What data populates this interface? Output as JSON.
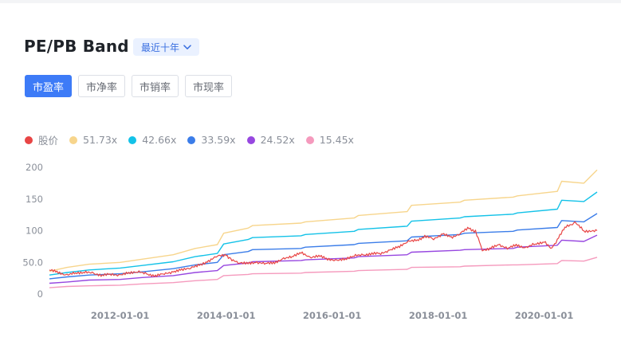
{
  "header": {
    "title": "PE/PB Band",
    "period_label": "最近十年"
  },
  "tabs": [
    {
      "label": "市盈率",
      "active": true
    },
    {
      "label": "市净率",
      "active": false
    },
    {
      "label": "市销率",
      "active": false
    },
    {
      "label": "市现率",
      "active": false
    }
  ],
  "colors": {
    "accent": "#3d7bf7",
    "price": "#e84545",
    "band1": "#f7d58c",
    "band2": "#13c2e8",
    "band3": "#3b7de9",
    "band4": "#9747e0",
    "band5": "#f59abd"
  },
  "chart_data": {
    "type": "line",
    "x_start": "2010-09-01",
    "x_end": "2020-12-31",
    "xticks": [
      "2012-01-01",
      "2014-01-01",
      "2016-01-01",
      "2018-01-01",
      "2020-01-01"
    ],
    "yticks": [
      "0",
      "50.0",
      "100",
      "150",
      "200"
    ],
    "ylim": [
      0,
      200
    ],
    "grid": false,
    "legend_position": "top-left",
    "series": [
      {
        "name": "股价",
        "color": "#e84545",
        "width": 1.2,
        "points": [
          [
            "2010-09-01",
            38
          ],
          [
            "2010-11-01",
            34
          ],
          [
            "2011-01-01",
            30
          ],
          [
            "2011-03-01",
            33
          ],
          [
            "2011-05-01",
            35
          ],
          [
            "2011-07-01",
            32
          ],
          [
            "2011-09-01",
            30
          ],
          [
            "2011-11-01",
            31
          ],
          [
            "2012-01-01",
            30
          ],
          [
            "2012-03-01",
            33
          ],
          [
            "2012-05-01",
            36
          ],
          [
            "2012-07-01",
            31
          ],
          [
            "2012-09-01",
            29
          ],
          [
            "2012-11-01",
            32
          ],
          [
            "2013-01-01",
            35
          ],
          [
            "2013-03-01",
            38
          ],
          [
            "2013-05-01",
            42
          ],
          [
            "2013-07-01",
            45
          ],
          [
            "2013-09-01",
            52
          ],
          [
            "2013-11-01",
            60
          ],
          [
            "2014-01-01",
            62
          ],
          [
            "2014-02-01",
            54
          ],
          [
            "2014-04-01",
            50
          ],
          [
            "2014-06-01",
            48
          ],
          [
            "2014-08-01",
            50
          ],
          [
            "2014-10-01",
            48
          ],
          [
            "2014-12-01",
            50
          ],
          [
            "2015-02-01",
            55
          ],
          [
            "2015-04-01",
            60
          ],
          [
            "2015-06-01",
            65
          ],
          [
            "2015-08-01",
            58
          ],
          [
            "2015-10-01",
            60
          ],
          [
            "2015-12-01",
            56
          ],
          [
            "2016-02-01",
            52
          ],
          [
            "2016-04-01",
            56
          ],
          [
            "2016-06-01",
            60
          ],
          [
            "2016-08-01",
            62
          ],
          [
            "2016-10-01",
            63
          ],
          [
            "2016-12-01",
            65
          ],
          [
            "2017-02-01",
            68
          ],
          [
            "2017-04-01",
            75
          ],
          [
            "2017-06-01",
            82
          ],
          [
            "2017-08-01",
            85
          ],
          [
            "2017-10-01",
            90
          ],
          [
            "2017-12-01",
            88
          ],
          [
            "2018-02-01",
            94
          ],
          [
            "2018-04-01",
            90
          ],
          [
            "2018-06-01",
            95
          ],
          [
            "2018-08-01",
            105
          ],
          [
            "2018-09-15",
            98
          ],
          [
            "2018-11-01",
            70
          ],
          [
            "2019-01-01",
            72
          ],
          [
            "2019-03-01",
            78
          ],
          [
            "2019-05-01",
            72
          ],
          [
            "2019-07-01",
            78
          ],
          [
            "2019-09-01",
            72
          ],
          [
            "2019-11-01",
            80
          ],
          [
            "2020-01-01",
            82
          ],
          [
            "2020-02-15",
            72
          ],
          [
            "2020-04-01",
            85
          ],
          [
            "2020-06-01",
            108
          ],
          [
            "2020-08-01",
            112
          ],
          [
            "2020-10-01",
            100
          ],
          [
            "2020-12-31",
            100
          ]
        ]
      },
      {
        "name": "51.73x",
        "color": "#f7d58c",
        "width": 1.4,
        "points": [
          [
            "2010-09-01",
            36
          ],
          [
            "2011-01-01",
            42
          ],
          [
            "2011-06-01",
            47
          ],
          [
            "2012-01-01",
            50
          ],
          [
            "2012-06-01",
            55
          ],
          [
            "2013-01-01",
            62
          ],
          [
            "2013-06-01",
            72
          ],
          [
            "2013-11-01",
            78
          ],
          [
            "2013-12-15",
            96
          ],
          [
            "2014-06-01",
            104
          ],
          [
            "2014-07-01",
            108
          ],
          [
            "2015-06-01",
            112
          ],
          [
            "2015-07-01",
            114
          ],
          [
            "2016-06-01",
            120
          ],
          [
            "2016-07-01",
            124
          ],
          [
            "2017-06-01",
            130
          ],
          [
            "2017-07-01",
            140
          ],
          [
            "2018-06-01",
            145
          ],
          [
            "2018-07-01",
            148
          ],
          [
            "2019-06-01",
            153
          ],
          [
            "2019-07-01",
            155
          ],
          [
            "2020-04-01",
            162
          ],
          [
            "2020-05-01",
            178
          ],
          [
            "2020-10-01",
            175
          ],
          [
            "2020-12-31",
            196
          ]
        ]
      },
      {
        "name": "42.66x",
        "color": "#13c2e8",
        "width": 1.4,
        "points": [
          [
            "2010-09-01",
            30
          ],
          [
            "2011-01-01",
            34
          ],
          [
            "2011-06-01",
            38
          ],
          [
            "2012-01-01",
            41
          ],
          [
            "2012-06-01",
            45
          ],
          [
            "2013-01-01",
            51
          ],
          [
            "2013-06-01",
            59
          ],
          [
            "2013-11-01",
            64
          ],
          [
            "2013-12-15",
            79
          ],
          [
            "2014-06-01",
            86
          ],
          [
            "2014-07-01",
            89
          ],
          [
            "2015-06-01",
            92
          ],
          [
            "2015-07-01",
            94
          ],
          [
            "2016-06-01",
            99
          ],
          [
            "2016-07-01",
            102
          ],
          [
            "2017-06-01",
            107
          ],
          [
            "2017-07-01",
            115
          ],
          [
            "2018-06-01",
            120
          ],
          [
            "2018-07-01",
            122
          ],
          [
            "2019-06-01",
            126
          ],
          [
            "2019-07-01",
            128
          ],
          [
            "2020-04-01",
            134
          ],
          [
            "2020-05-01",
            148
          ],
          [
            "2020-10-01",
            146
          ],
          [
            "2020-12-31",
            161
          ]
        ]
      },
      {
        "name": "33.59x",
        "color": "#3b7de9",
        "width": 1.4,
        "points": [
          [
            "2010-09-01",
            24
          ],
          [
            "2011-01-01",
            27
          ],
          [
            "2011-06-01",
            30
          ],
          [
            "2012-01-01",
            32
          ],
          [
            "2012-06-01",
            35
          ],
          [
            "2013-01-01",
            40
          ],
          [
            "2013-06-01",
            46
          ],
          [
            "2013-11-01",
            50
          ],
          [
            "2013-12-15",
            62
          ],
          [
            "2014-06-01",
            67
          ],
          [
            "2014-07-01",
            70
          ],
          [
            "2015-06-01",
            72
          ],
          [
            "2015-07-01",
            74
          ],
          [
            "2016-06-01",
            78
          ],
          [
            "2016-07-01",
            80
          ],
          [
            "2017-06-01",
            84
          ],
          [
            "2017-07-01",
            90
          ],
          [
            "2018-06-01",
            94
          ],
          [
            "2018-07-01",
            96
          ],
          [
            "2019-06-01",
            99
          ],
          [
            "2019-07-01",
            101
          ],
          [
            "2020-04-01",
            105
          ],
          [
            "2020-05-01",
            116
          ],
          [
            "2020-10-01",
            114
          ],
          [
            "2020-12-31",
            127
          ]
        ]
      },
      {
        "name": "24.52x",
        "color": "#9747e0",
        "width": 1.4,
        "points": [
          [
            "2010-09-01",
            17
          ],
          [
            "2011-01-01",
            19
          ],
          [
            "2011-06-01",
            22
          ],
          [
            "2012-01-01",
            23
          ],
          [
            "2012-06-01",
            26
          ],
          [
            "2013-01-01",
            29
          ],
          [
            "2013-06-01",
            34
          ],
          [
            "2013-11-01",
            37
          ],
          [
            "2013-12-15",
            45
          ],
          [
            "2014-06-01",
            49
          ],
          [
            "2014-07-01",
            51
          ],
          [
            "2015-06-01",
            53
          ],
          [
            "2015-07-01",
            54
          ],
          [
            "2016-06-01",
            57
          ],
          [
            "2016-07-01",
            59
          ],
          [
            "2017-06-01",
            62
          ],
          [
            "2017-07-01",
            66
          ],
          [
            "2018-06-01",
            69
          ],
          [
            "2018-07-01",
            70
          ],
          [
            "2019-06-01",
            72
          ],
          [
            "2019-07-01",
            74
          ],
          [
            "2020-04-01",
            77
          ],
          [
            "2020-05-01",
            85
          ],
          [
            "2020-10-01",
            83
          ],
          [
            "2020-12-31",
            93
          ]
        ]
      },
      {
        "name": "15.45x",
        "color": "#f59abd",
        "width": 1.4,
        "points": [
          [
            "2010-09-01",
            10
          ],
          [
            "2011-01-01",
            12
          ],
          [
            "2011-06-01",
            13
          ],
          [
            "2012-01-01",
            14
          ],
          [
            "2012-06-01",
            16
          ],
          [
            "2013-01-01",
            18
          ],
          [
            "2013-06-01",
            21
          ],
          [
            "2013-11-01",
            23
          ],
          [
            "2013-12-15",
            29
          ],
          [
            "2014-06-01",
            31
          ],
          [
            "2014-07-01",
            32
          ],
          [
            "2015-06-01",
            33
          ],
          [
            "2015-07-01",
            34
          ],
          [
            "2016-06-01",
            36
          ],
          [
            "2016-07-01",
            37
          ],
          [
            "2017-06-01",
            39
          ],
          [
            "2017-07-01",
            42
          ],
          [
            "2018-06-01",
            43
          ],
          [
            "2018-07-01",
            44
          ],
          [
            "2019-06-01",
            46
          ],
          [
            "2019-07-01",
            46
          ],
          [
            "2020-04-01",
            48
          ],
          [
            "2020-05-01",
            53
          ],
          [
            "2020-10-01",
            52
          ],
          [
            "2020-12-31",
            58
          ]
        ]
      }
    ]
  }
}
